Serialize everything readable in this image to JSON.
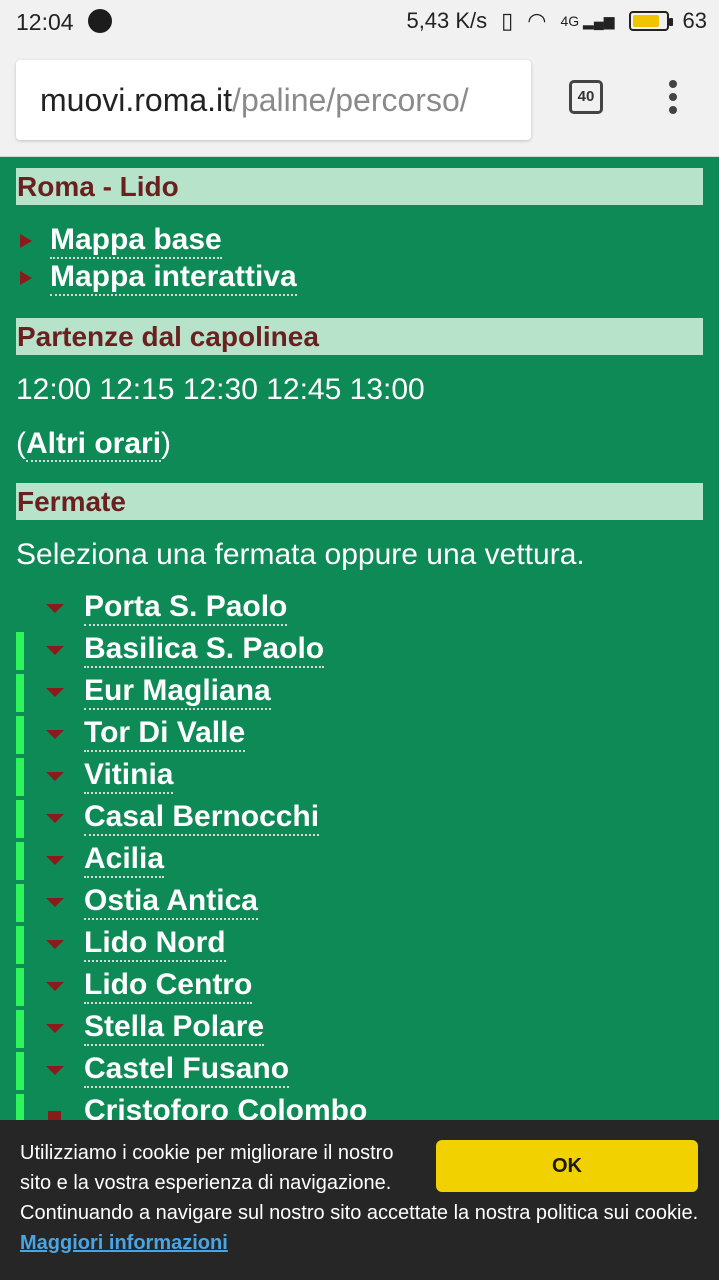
{
  "status_bar": {
    "time": "12:04",
    "net_speed": "5,43 K/s",
    "network": "4G",
    "battery": "63"
  },
  "browser": {
    "url_host": "muovi.roma.it",
    "url_path": "/paline/percorso/",
    "tab_count": "40"
  },
  "page": {
    "route_title": "Roma - Lido",
    "map_links": [
      "Mappa base",
      "Mappa interattiva"
    ],
    "departures_header": "Partenze dal capolinea",
    "departure_times": "12:00 12:15 12:30 12:45 13:00",
    "altri_open": "(",
    "altri_link": "Altri orari",
    "altri_close": ")",
    "stops_header": "Fermate",
    "stops_instruction": "Seleziona una fermata oppure una vettura.",
    "stops": [
      "Porta S. Paolo",
      "Basilica S. Paolo",
      "Eur Magliana",
      "Tor Di Valle",
      "Vitinia",
      "Casal Bernocchi",
      "Acilia",
      "Ostia Antica",
      "Lido Nord",
      "Lido Centro",
      "Stella Polare",
      "Castel Fusano",
      "Cristoforo Colombo"
    ]
  },
  "cookie_banner": {
    "text_line1": "Utilizziamo i cookie per migliorare il nostro sito e la vostra esperienza di navigazione.",
    "text_line2": "Continuando a navigare sul nostro sito accettate la nostra politica sui cookie.",
    "link": "Maggiori informazioni",
    "ok_label": "OK"
  },
  "colors": {
    "page_background": "#0d8a55",
    "section_header_bg": "#b7e3cb",
    "section_header_text": "#6b1f1f",
    "route_line": "#2ef55a",
    "marker": "#8b1a1a",
    "ok_button": "#f1d100"
  }
}
